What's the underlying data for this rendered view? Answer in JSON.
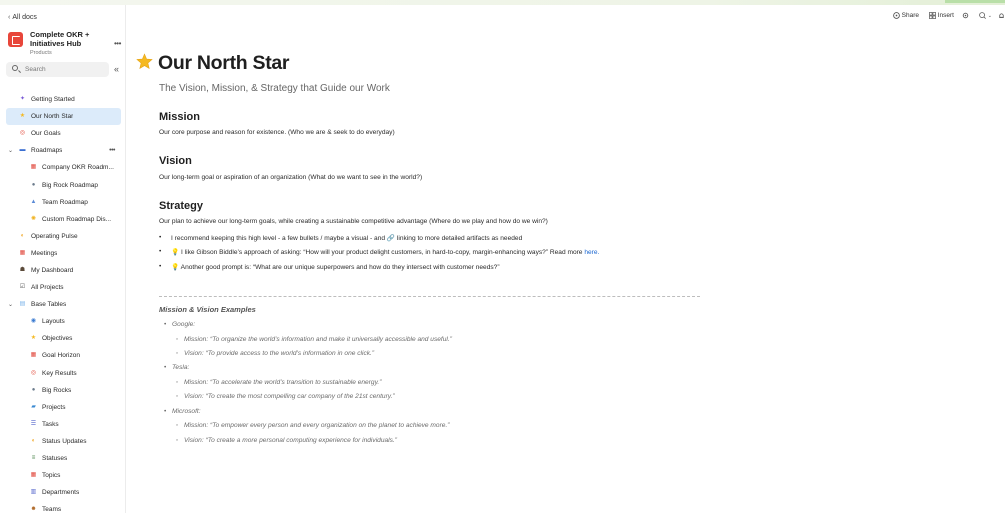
{
  "sidebar": {
    "back_label": "All docs",
    "doc_title": "Complete OKR + Initiatives Hub",
    "doc_subtitle": "Products",
    "search_placeholder": "Search",
    "items": [
      {
        "label": "Getting Started",
        "icon": "sparkle-icon",
        "level": 0
      },
      {
        "label": "Our North Star",
        "icon": "star-icon",
        "level": 0,
        "active": true
      },
      {
        "label": "Our Goals",
        "icon": "target-icon",
        "level": 0
      },
      {
        "label": "Roadmaps",
        "icon": "car-icon",
        "level": 0,
        "expanded": true
      },
      {
        "label": "Company OKR Roadm...",
        "icon": "calendar-icon",
        "level": 1
      },
      {
        "label": "Big Rock Roadmap",
        "icon": "rock-icon",
        "level": 1
      },
      {
        "label": "Team Roadmap",
        "icon": "mountain-icon",
        "level": 1
      },
      {
        "label": "Custom Roadmap Dis...",
        "icon": "bulb-icon",
        "level": 1
      },
      {
        "label": "Operating Pulse",
        "icon": "pulse-icon",
        "level": 0
      },
      {
        "label": "Meetings",
        "icon": "calendar-icon",
        "level": 0
      },
      {
        "label": "My Dashboard",
        "icon": "person-icon",
        "level": 0
      },
      {
        "label": "All Projects",
        "icon": "checkbox-icon",
        "level": 0
      },
      {
        "label": "Base Tables",
        "icon": "table-icon",
        "level": 0,
        "expanded": true
      },
      {
        "label": "Layouts",
        "icon": "eye-icon",
        "level": 1
      },
      {
        "label": "Objectives",
        "icon": "star-icon",
        "level": 1
      },
      {
        "label": "Goal Horizon",
        "icon": "calendar-icon",
        "level": 1
      },
      {
        "label": "Key Results",
        "icon": "target-icon",
        "level": 1
      },
      {
        "label": "Big Rocks",
        "icon": "rock-icon",
        "level": 1
      },
      {
        "label": "Projects",
        "icon": "folder-icon",
        "level": 1
      },
      {
        "label": "Tasks",
        "icon": "list-icon",
        "level": 1
      },
      {
        "label": "Status Updates",
        "icon": "pulse-icon",
        "level": 1
      },
      {
        "label": "Statuses",
        "icon": "stack-icon",
        "level": 1
      },
      {
        "label": "Topics",
        "icon": "calendar-icon",
        "level": 1
      },
      {
        "label": "Departments",
        "icon": "building-icon",
        "level": 1
      },
      {
        "label": "Teams",
        "icon": "team-icon",
        "level": 1
      }
    ]
  },
  "toolbar": {
    "share_label": "Share",
    "insert_label": "Insert"
  },
  "page": {
    "title": "Our North Star",
    "subtitle": "The Vision, Mission, & Strategy that Guide our Work",
    "mission_heading": "Mission",
    "mission_text": "Our core purpose and reason for existence. (Who we are & seek to do everyday)",
    "vision_heading": "Vision",
    "vision_text": "Our long-term goal or aspiration of an organization (What do we want to see in the world?)",
    "strategy_heading": "Strategy",
    "strategy_text": "Our plan to achieve our long-term goals, while creating a sustainable competitive advantage (Where do we play and how do we win?)",
    "bullet1": "I recommend keeping this high level - a few bullets / maybe a visual - and 🔗 linking to more detailed artifacts as needed",
    "bullet2": "💡 I like Gibson Biddle’s approach of asking: “How will your product delight customers, in hard-to-copy, margin-enhancing ways?” Read more",
    "bullet2_link": "here.",
    "bullet3": "💡 Another good prompt is: “What are our unique superpowers and how do they intersect with customer needs?”",
    "examples_title": "Mission & Vision Examples",
    "examples": [
      {
        "company": "Google:",
        "mission": "Mission: “To organize the world’s information and make it universally accessible and useful.”",
        "vision": "Vision: “To provide access to the world’s information in one click.”"
      },
      {
        "company": "Tesla:",
        "mission": "Mission: “To accelerate the world’s transition to sustainable energy.”",
        "vision": "Vision: “To create the most compelling car company of the 21st century.”"
      },
      {
        "company": "Microsoft:",
        "mission": "Mission: “To empower every person and every organization on the planet to achieve more.”",
        "vision": "Vision: “To create a more personal computing experience for individuals.”"
      }
    ]
  },
  "colors": {
    "accent": "#dcebfa",
    "brand": "#e8463a",
    "link": "#1a66d0"
  }
}
